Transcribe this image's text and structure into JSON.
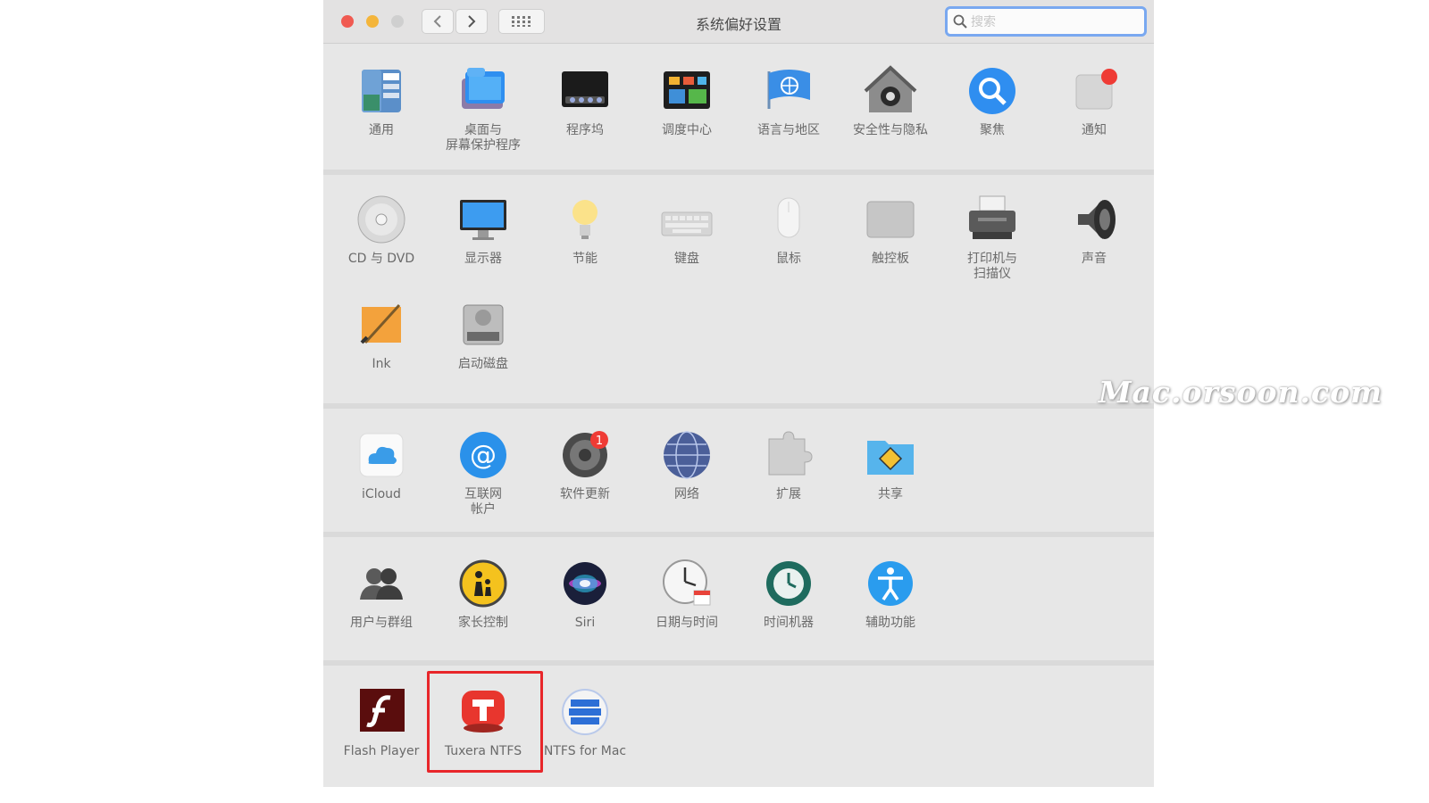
{
  "window": {
    "title": "系统偏好设置",
    "search_placeholder": "搜索",
    "traffic_colors": [
      "#f05a51",
      "#f4b53b",
      "#cfcfcf"
    ]
  },
  "sections": [
    {
      "panes": [
        {
          "label": "通用",
          "icon": "general-icon"
        },
        {
          "label": "桌面与\n屏幕保护程序",
          "icon": "desktop-screensaver-icon"
        },
        {
          "label": "程序坞",
          "icon": "dock-icon"
        },
        {
          "label": "调度中心",
          "icon": "mission-control-icon"
        },
        {
          "label": "语言与地区",
          "icon": "language-region-icon"
        },
        {
          "label": "安全性与隐私",
          "icon": "security-privacy-icon"
        },
        {
          "label": "聚焦",
          "icon": "spotlight-icon"
        },
        {
          "label": "通知",
          "icon": "notifications-icon"
        }
      ]
    },
    {
      "panes": [
        {
          "label": "CD 与 DVD",
          "icon": "cd-dvd-icon"
        },
        {
          "label": "显示器",
          "icon": "displays-icon"
        },
        {
          "label": "节能",
          "icon": "energy-saver-icon"
        },
        {
          "label": "键盘",
          "icon": "keyboard-icon"
        },
        {
          "label": "鼠标",
          "icon": "mouse-icon"
        },
        {
          "label": "触控板",
          "icon": "trackpad-icon"
        },
        {
          "label": "打印机与\n扫描仪",
          "icon": "printers-scanners-icon"
        },
        {
          "label": "声音",
          "icon": "sound-icon"
        },
        {
          "label": "Ink",
          "icon": "ink-icon"
        },
        {
          "label": "启动磁盘",
          "icon": "startup-disk-icon"
        }
      ]
    },
    {
      "panes": [
        {
          "label": "iCloud",
          "icon": "icloud-icon"
        },
        {
          "label": "互联网\n帐户",
          "icon": "internet-accounts-icon"
        },
        {
          "label": "软件更新",
          "icon": "software-update-icon",
          "badge": "1"
        },
        {
          "label": "网络",
          "icon": "network-icon"
        },
        {
          "label": "扩展",
          "icon": "extensions-icon"
        },
        {
          "label": "共享",
          "icon": "sharing-icon"
        }
      ]
    },
    {
      "panes": [
        {
          "label": "用户与群组",
          "icon": "users-groups-icon"
        },
        {
          "label": "家长控制",
          "icon": "parental-controls-icon"
        },
        {
          "label": "Siri",
          "icon": "siri-icon"
        },
        {
          "label": "日期与时间",
          "icon": "date-time-icon"
        },
        {
          "label": "时间机器",
          "icon": "time-machine-icon"
        },
        {
          "label": "辅助功能",
          "icon": "accessibility-icon"
        }
      ]
    },
    {
      "panes": [
        {
          "label": "Flash Player",
          "icon": "flash-player-icon"
        },
        {
          "label": "Tuxera NTFS",
          "icon": "tuxera-ntfs-icon"
        },
        {
          "label": "NTFS for Mac",
          "icon": "ntfs-for-mac-icon"
        }
      ]
    }
  ],
  "highlight_color": "#e8262a",
  "watermark": "Mac.orsoon.com"
}
